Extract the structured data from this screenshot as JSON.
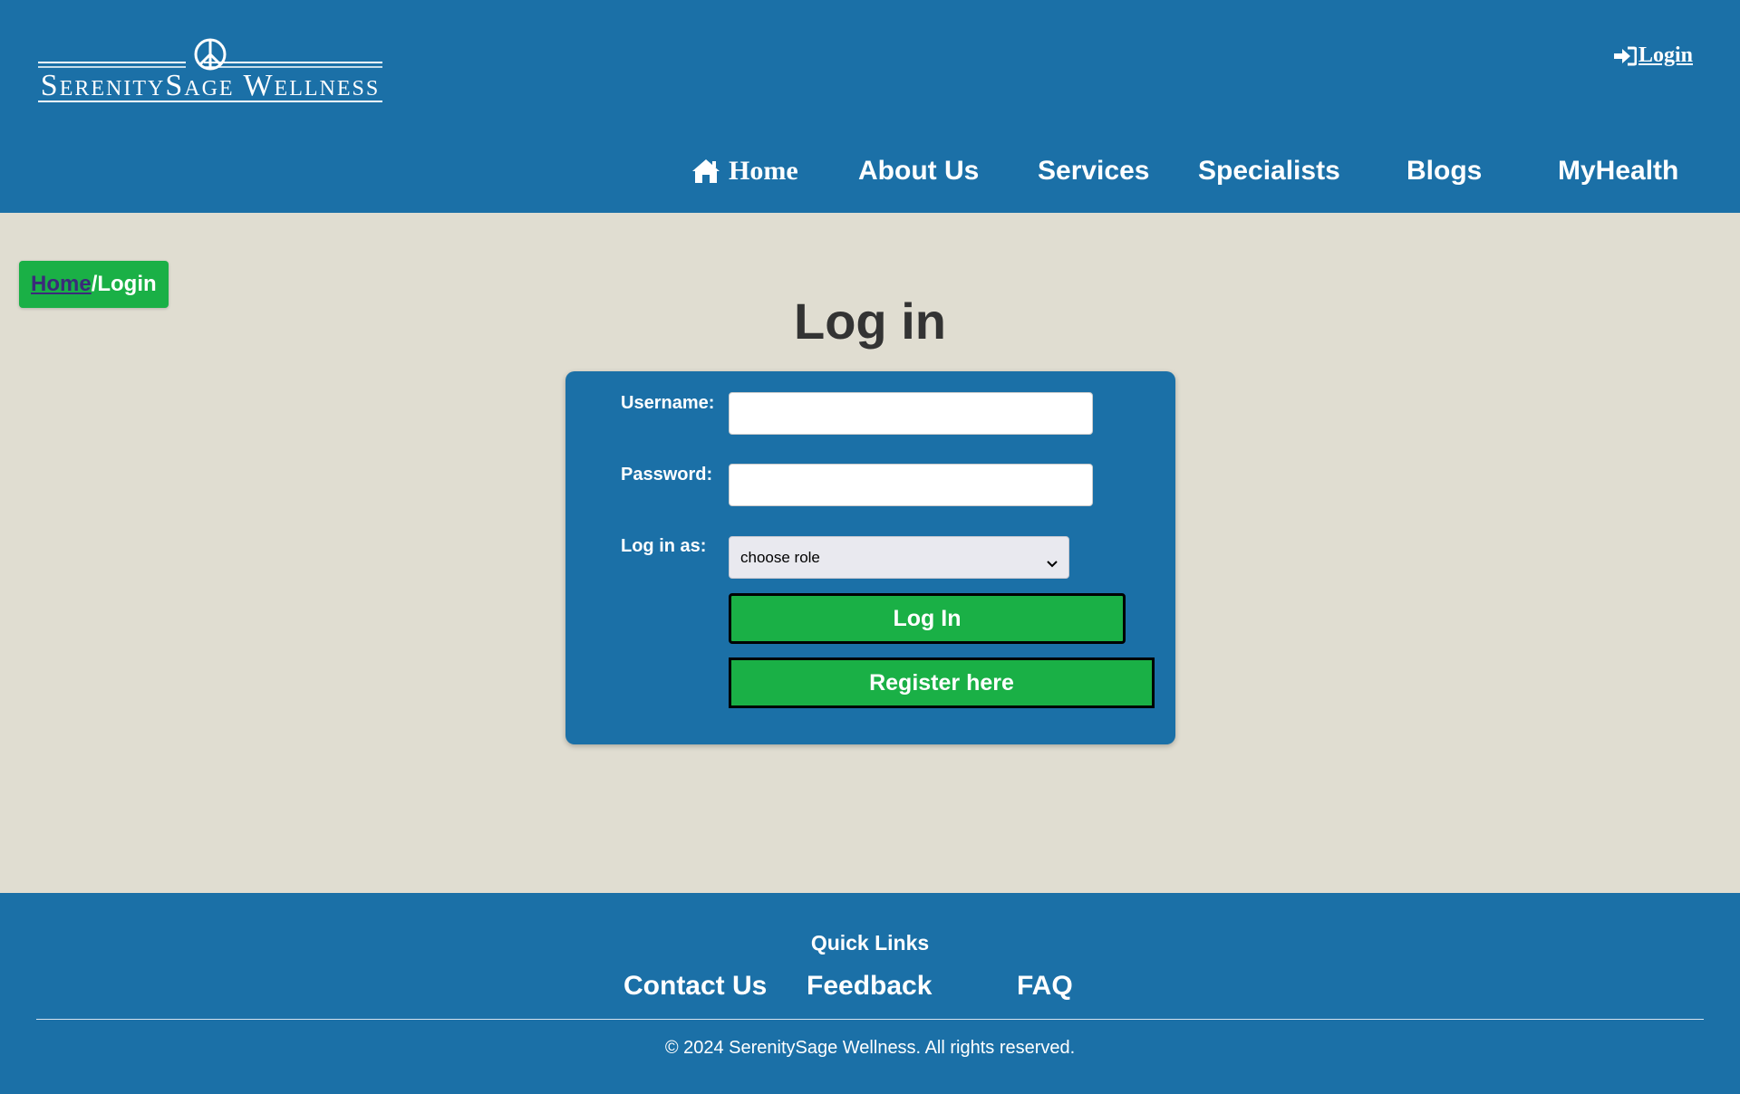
{
  "brand": {
    "name": "SerenitySage Wellness",
    "logo_symbol": "peace-sign"
  },
  "header": {
    "login_link": "Login"
  },
  "nav": {
    "home": "Home",
    "about": "About Us",
    "services": "Services",
    "specialists": "Specialists",
    "blogs": "Blogs",
    "myhealth": "MyHealth"
  },
  "breadcrumb": {
    "home": "Home",
    "current": "/Login"
  },
  "page": {
    "title": "Log in"
  },
  "form": {
    "username_label": "Username:",
    "username_value": "",
    "password_label": "Password:",
    "password_value": "",
    "role_label": "Log in as:",
    "role_selected": "choose role",
    "login_button": "Log In",
    "register_button": "Register here"
  },
  "footer": {
    "quick_links_title": "Quick Links",
    "links": [
      "Contact Us",
      "Feedback",
      "FAQ"
    ],
    "copyright": "© 2024 SerenitySage Wellness. All rights reserved."
  },
  "colors": {
    "primary_blue": "#1b70a7",
    "accent_green": "#1ab046",
    "background": "#e0ddd1",
    "title_text": "#333333"
  }
}
